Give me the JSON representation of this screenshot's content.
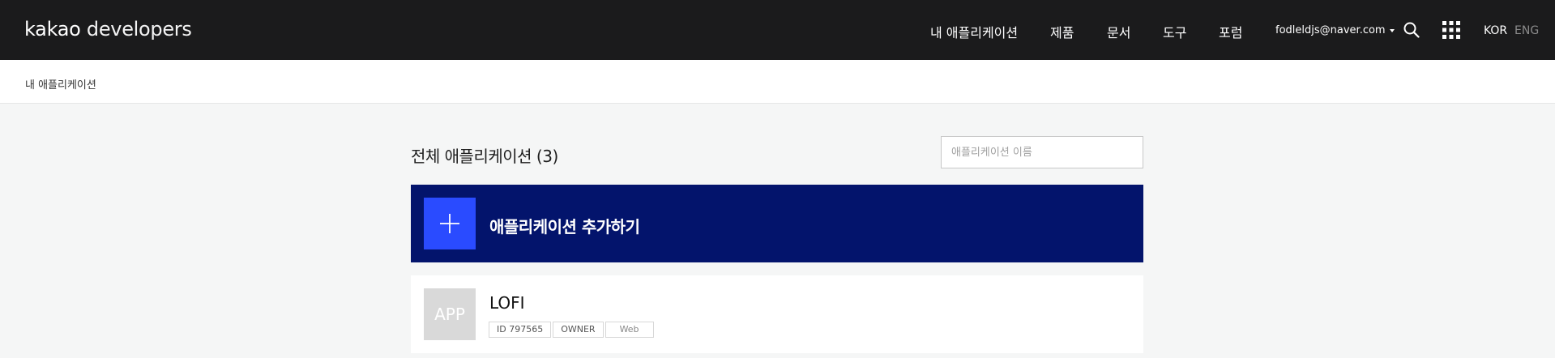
{
  "header": {
    "logo_brand": "kakao",
    "logo_suffix": " developers",
    "nav": [
      {
        "label": "내 애플리케이션"
      },
      {
        "label": "제품"
      },
      {
        "label": "문서"
      },
      {
        "label": "도구"
      },
      {
        "label": "포럼"
      }
    ],
    "account_email": "fodleldjs@naver.com",
    "lang_kor": "KOR",
    "lang_eng": "ENG"
  },
  "breadcrumb": "내 애플리케이션",
  "main": {
    "title": "전체 애플리케이션 (3)",
    "search_placeholder": "애플리케이션 이름",
    "add_app_label": "애플리케이션 추가하기",
    "apps": [
      {
        "thumb_text": "APP",
        "name": "LOFI",
        "tags": [
          "ID 797565",
          "OWNER",
          "Web"
        ]
      }
    ]
  },
  "colors": {
    "header_bg": "#1b1b1c",
    "add_app_bg": "#03146c",
    "add_app_accent": "#2a4bff",
    "page_bg": "#f5f6f6"
  }
}
